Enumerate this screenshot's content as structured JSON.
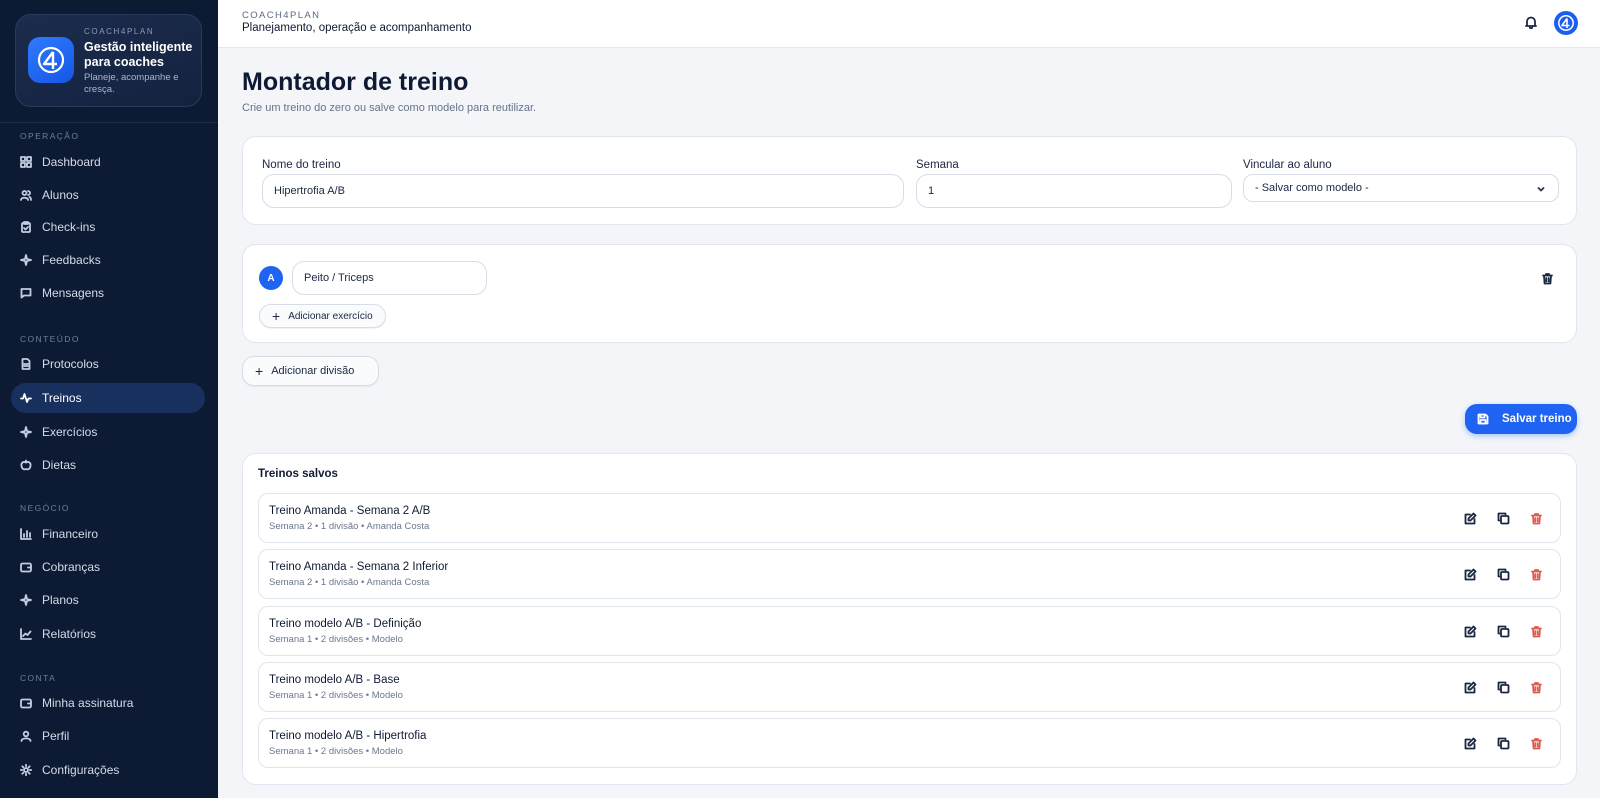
{
  "brand": {
    "kicker": "COACH4PLAN",
    "title": "Gestão inteligente para coaches",
    "subtitle": "Planeje, acompanhe e cresça."
  },
  "sidebar": {
    "sections": [
      {
        "label": "OPERAÇÃO",
        "items": [
          {
            "label": "Dashboard",
            "icon": "grid-icon"
          },
          {
            "label": "Alunos",
            "icon": "users-icon"
          },
          {
            "label": "Check-ins",
            "icon": "clipboard-check-icon"
          },
          {
            "label": "Feedbacks",
            "icon": "sparkle-icon"
          },
          {
            "label": "Mensagens",
            "icon": "chat-icon"
          }
        ]
      },
      {
        "label": "CONTEÚDO",
        "items": [
          {
            "label": "Protocolos",
            "icon": "document-icon"
          },
          {
            "label": "Treinos",
            "icon": "activity-icon",
            "active": true
          },
          {
            "label": "Exercícios",
            "icon": "sparkle-icon"
          },
          {
            "label": "Dietas",
            "icon": "apple-icon"
          }
        ]
      },
      {
        "label": "NEGÓCIO",
        "items": [
          {
            "label": "Financeiro",
            "icon": "bar-chart-icon"
          },
          {
            "label": "Cobranças",
            "icon": "wallet-icon"
          },
          {
            "label": "Planos",
            "icon": "sparkle-icon"
          },
          {
            "label": "Relatórios",
            "icon": "line-chart-icon"
          }
        ]
      },
      {
        "label": "CONTA",
        "items": [
          {
            "label": "Minha assinatura",
            "icon": "wallet-icon"
          },
          {
            "label": "Perfil",
            "icon": "user-icon"
          },
          {
            "label": "Configurações",
            "icon": "gear-icon"
          }
        ]
      }
    ]
  },
  "topbar": {
    "kicker": "COACH4PLAN",
    "title": "Planejamento, operação e acompanhamento"
  },
  "page": {
    "title": "Montador de treino",
    "subtitle": "Crie um treino do zero ou salve como modelo para reutilizar."
  },
  "form": {
    "name_label": "Nome do treino",
    "name_value": "Hipertrofia A/B",
    "week_label": "Semana",
    "week_value": "1",
    "student_label": "Vincular ao aluno",
    "student_value": "- Salvar como modelo -"
  },
  "division": {
    "letter": "A",
    "name": "Peito / Triceps",
    "add_exercise_label": "Adicionar exercício"
  },
  "add_division_label": "Adicionar divisão",
  "save_label": "Salvar treino",
  "saved": {
    "title": "Treinos salvos",
    "rows": [
      {
        "name": "Treino Amanda - Semana 2 A/B",
        "meta": "Semana 2 • 1 divisão • Amanda Costa"
      },
      {
        "name": "Treino Amanda - Semana 2 Inferior",
        "meta": "Semana 2 • 1 divisão • Amanda Costa"
      },
      {
        "name": "Treino modelo A/B - Definição",
        "meta": "Semana 1 • 2 divisões • Modelo"
      },
      {
        "name": "Treino modelo A/B - Base",
        "meta": "Semana 1 • 2 divisões • Modelo"
      },
      {
        "name": "Treino modelo A/B - Hipertrofia",
        "meta": "Semana 1 • 2 divisões • Modelo"
      }
    ]
  },
  "colors": {
    "accent": "#1f63f2",
    "sidebar": "#0d1a33",
    "danger": "#e05a4f"
  }
}
